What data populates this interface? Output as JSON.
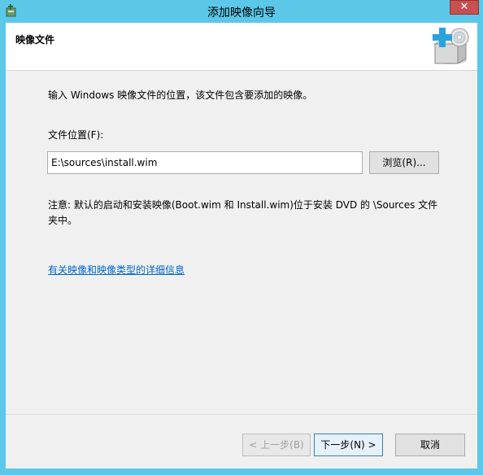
{
  "window": {
    "title": "添加映像向导",
    "close_glyph": "✕"
  },
  "header": {
    "title": "映像文件",
    "icon": "add-image-cd-icon"
  },
  "main": {
    "instruction": "输入 Windows 映像文件的位置，该文件包含要添加的映像。",
    "location_label": "文件位置(F):",
    "location_value": "E:\\sources\\install.wim",
    "browse_label": "浏览(R)...",
    "note": "注意: 默认的启动和安装映像(Boot.wim 和 Install.wim)位于安装 DVD 的 \\Sources 文件夹中。",
    "link_text": "有关映像和映像类型的详细信息"
  },
  "footer": {
    "back_label": "< 上一步(B)",
    "next_label": "下一步(N) >",
    "cancel_label": "取消"
  },
  "colors": {
    "titlebar": "#5bc8ea",
    "link": "#0066cc",
    "close_button": "#c75050"
  }
}
